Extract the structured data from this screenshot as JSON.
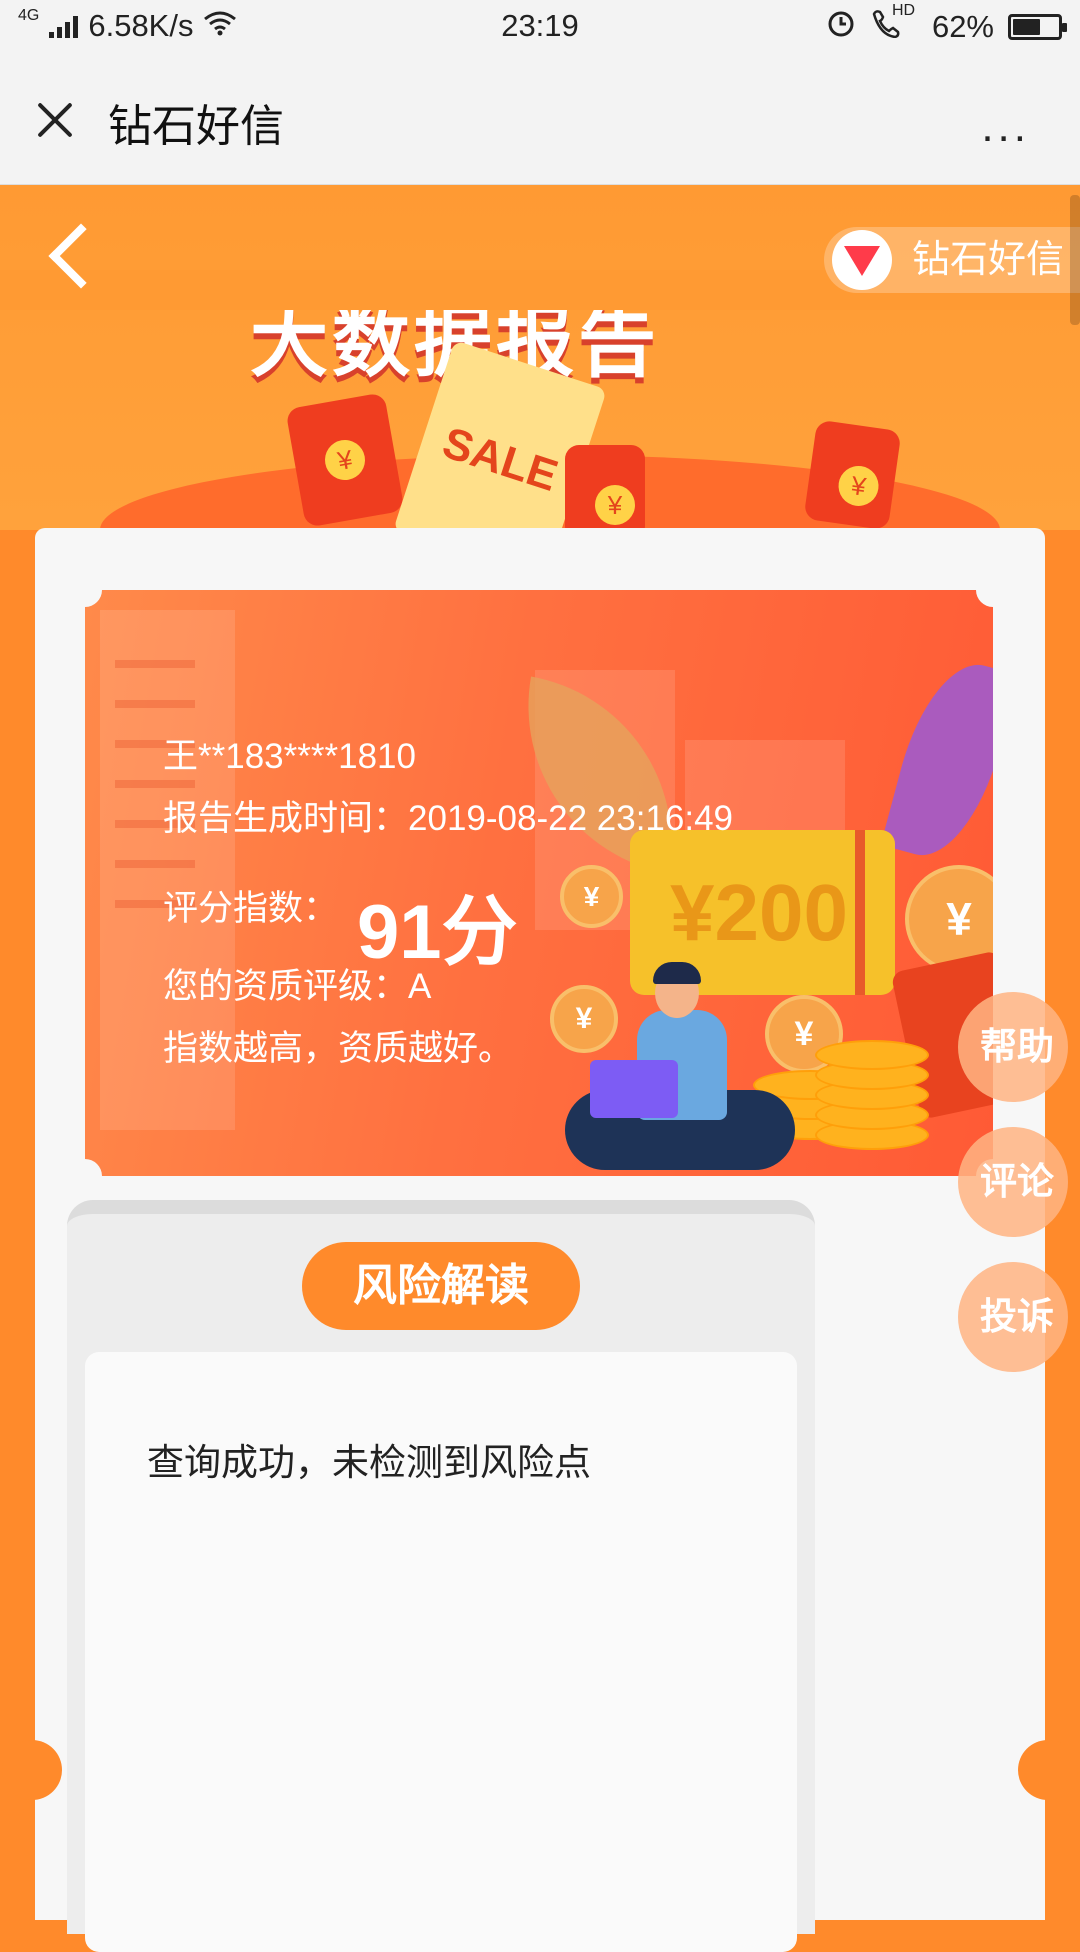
{
  "status_bar": {
    "network": "4G",
    "speed": "6.58K/s",
    "time": "23:19",
    "hd_label": "HD",
    "battery": "62%",
    "battery_level": 0.62
  },
  "titlebar": {
    "title": "钻石好信",
    "more": "..."
  },
  "hero": {
    "brand": "钻石好信",
    "title": "大数据报告",
    "sale": "SALE"
  },
  "report": {
    "user": "王**183****1810",
    "time_label": "报告生成时间：",
    "time_value": "2019-08-22 23:16:49",
    "score_label": "评分指数：",
    "score": "91分",
    "grade_label": "您的资质评级：",
    "grade": "A",
    "note": "指数越高，资质越好。",
    "gift_text": "¥200"
  },
  "risk": {
    "button": "风险解读",
    "result": "查询成功，未检测到风险点"
  },
  "side_buttons": {
    "help": "帮助",
    "comment": "评论",
    "complain": "投诉"
  }
}
